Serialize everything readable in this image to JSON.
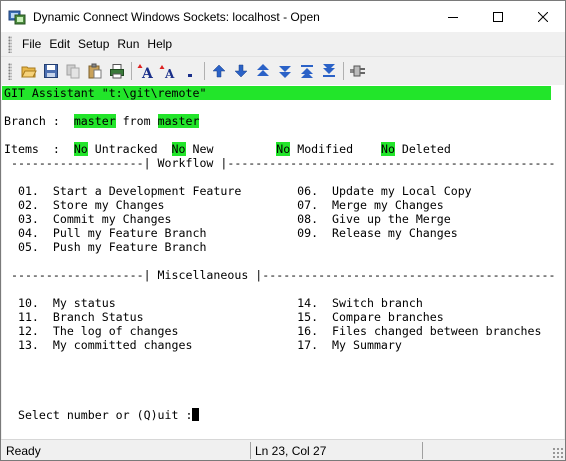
{
  "window": {
    "title": "Dynamic Connect Windows Sockets: localhost - Open"
  },
  "menu": {
    "items": [
      "File",
      "Edit",
      "Setup",
      "Run",
      "Help"
    ]
  },
  "toolbar": {
    "icons": [
      "open-folder-icon",
      "save-disk-icon",
      "copy-icon",
      "paste-icon",
      "print-icon",
      "font-increase-icon",
      "font-decrease-icon",
      "small-dot-icon",
      "arrow-up-icon",
      "arrow-down-icon",
      "double-up-icon",
      "double-down-icon",
      "top-icon",
      "bottom-icon",
      "plug-icon"
    ]
  },
  "terminal": {
    "title_line": "GIT Assistant \"t:\\git\\remote\"",
    "branch_prefix": "Branch :  ",
    "branch_name": "master",
    "branch_from": " from ",
    "branch_source": "master",
    "items_prefix": "Items  :  ",
    "items_untracked_val": "No",
    "items_untracked_label": " Untracked  ",
    "items_new_val": "No",
    "items_new_label": " New         ",
    "items_modified_val": "No",
    "items_modified_label": " Modified    ",
    "items_deleted_val": "No",
    "items_deleted_label": " Deleted",
    "workflow_header": " -------------------| Workflow |-----------------------------------------------",
    "workflow_rows": [
      "  01.  Start a Development Feature        06.  Update my Local Copy",
      "  02.  Store my Changes                   07.  Merge my Changes",
      "  03.  Commit my Changes                  08.  Give up the Merge",
      "  04.  Pull my Feature Branch             09.  Release my Changes",
      "  05.  Push my Feature Branch"
    ],
    "misc_header": " -------------------| Miscellaneous |------------------------------------------",
    "misc_rows": [
      "  10.  My status                          14.  Switch branch",
      "  11.  Branch Status                      15.  Compare branches",
      "  12.  The log of changes                 16.  Files changed between branches",
      "  13.  My committed changes               17.  My Summary"
    ],
    "prompt": "  Select number or (Q)uit :"
  },
  "status": {
    "ready": "Ready",
    "position": "Ln 23, Col 27"
  },
  "colors": {
    "highlight": "#22e52a",
    "terminal_bg": "#ffffff",
    "chrome_bg": "#f0f0f0"
  }
}
